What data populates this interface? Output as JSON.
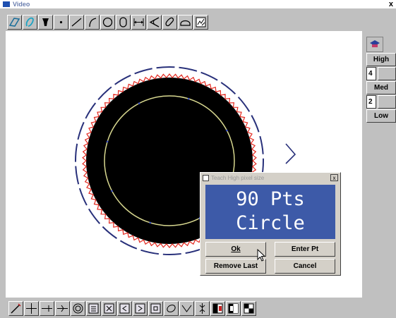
{
  "window": {
    "title": "Video",
    "close_label": "x"
  },
  "toolbar_top": {
    "tools": [
      "trace-icon",
      "freehand-icon",
      "probe-icon",
      "point-icon",
      "line-icon",
      "arc-icon",
      "circle-icon",
      "slot-icon",
      "distance-icon",
      "angle-icon",
      "contour-icon",
      "arc-segment-icon",
      "chart-icon"
    ]
  },
  "right_panel": {
    "icon": "teach-icon",
    "high_label": "High",
    "field1_value": "4",
    "med_label": "Med",
    "field2_value": "2",
    "low_label": "Low"
  },
  "toolbar_bottom": {
    "tools": [
      "wand-icon",
      "crosshair-icon",
      "edge-left-icon",
      "edge-right-icon",
      "target-icon",
      "box-a-icon",
      "box-b-icon",
      "box-c-icon",
      "box-d-icon",
      "box-e-icon",
      "ellipse-icon",
      "vee-icon",
      "focus-icon",
      "contrast-a-icon",
      "contrast-b-icon",
      "checker-icon"
    ]
  },
  "dialog": {
    "title": "Teach High pixel size",
    "close_label": "x",
    "display_line1": "90 Pts",
    "display_line2": "Circle",
    "ok_label": "Ok",
    "enter_pt_label": "Enter Pt",
    "remove_last_label": "Remove Last",
    "cancel_label": "Cancel"
  },
  "colors": {
    "disk": "#000000",
    "edge_points": "#e2261c",
    "inner_circle": "#d8d890",
    "outer_circle": "#28307a",
    "display_bg": "#3d5aa8"
  }
}
